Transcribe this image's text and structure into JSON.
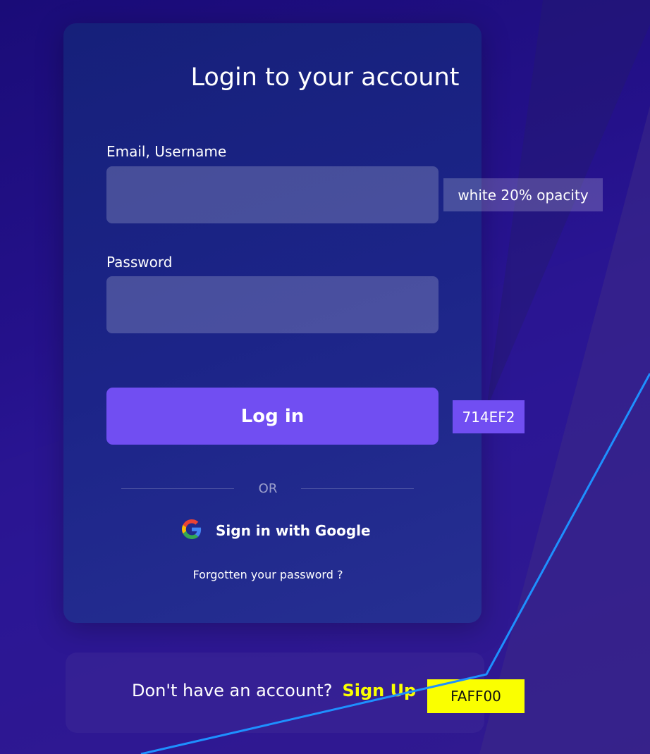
{
  "login": {
    "title": "Login to your account",
    "email_label": "Email, Username",
    "email_value": "",
    "password_label": "Password",
    "password_value": "",
    "login_button": "Log in",
    "or_text": "OR",
    "google_label": "Sign in with Google",
    "forgot_link": "Forgotten your password ?"
  },
  "signup": {
    "prompt": "Don't have an account?",
    "link": "Sign Up"
  },
  "annotations": {
    "input_note": "white  20% opacity",
    "button_color_note": "714EF2",
    "signup_color_note": "FAFF00"
  },
  "colors": {
    "accent": "#714EF2",
    "highlight": "#FAFF00",
    "input_bg": "rgba(255,255,255,0.2)",
    "guide_line": "#1E90FF"
  },
  "icons": {
    "google": "google-icon"
  }
}
